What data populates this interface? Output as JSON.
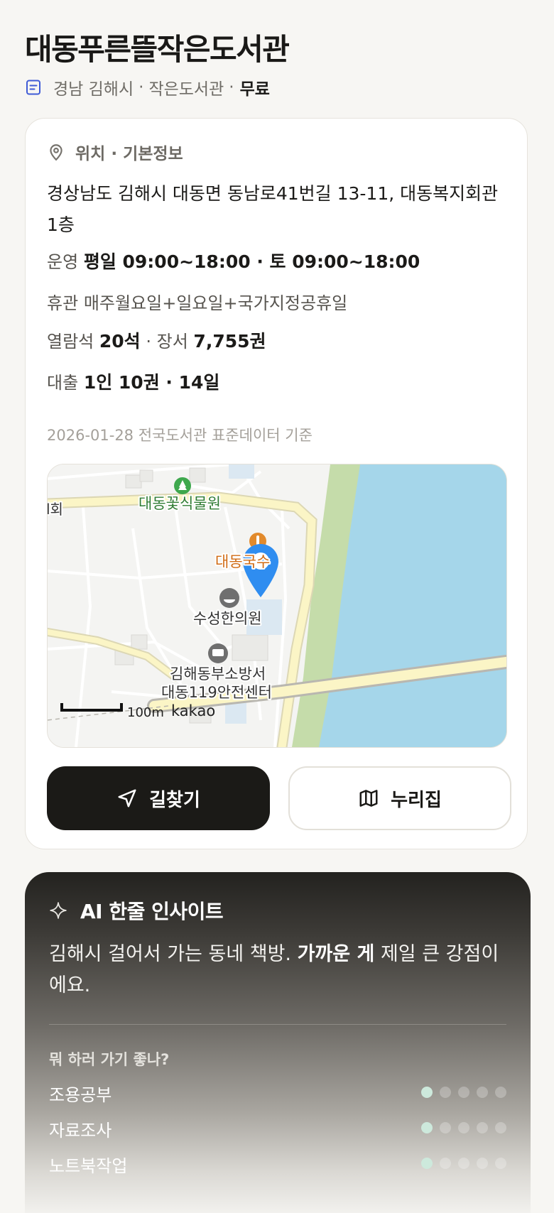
{
  "header": {
    "title": "대동푸른뜰작은도서관",
    "region": "경남 김해시",
    "sep1": "·",
    "type": "작은도서관",
    "sep2": "·",
    "fee": "무료"
  },
  "info": {
    "section_title": "위치 · 기본정보",
    "address": "경상남도 김해시 대동면 동남로41번길 13-11, 대동복지회관 1층",
    "hours_label": "운영",
    "hours_value": "평일 09:00~18:00 · 토 09:00~18:00",
    "closed_label": "휴관",
    "closed_value": "매주월요일+일요일+국가지정공휴일",
    "seats_label": "열람석",
    "seats_value": "20석",
    "sep": "·",
    "books_label": "장서",
    "books_value": "7,755권",
    "loan_label": "대출",
    "loan_value": "1인 10권 · 14일",
    "as_of": "2026-01-28 전국도서관 표준데이터 기준"
  },
  "map": {
    "labels": {
      "botanical": "대동꽃식물원",
      "left_partial": "l회",
      "restaurant": "대동국수",
      "clinic": "수성한의원",
      "fire1": "김해동부소방서",
      "fire2": "대동119안전센터",
      "scale": "100m",
      "brand": "kakao"
    },
    "colors": {
      "water": "#a5d6ea",
      "bank": "#c5dcaa",
      "road": "#fbf5c6",
      "pin": "#2f8df0"
    }
  },
  "actions": {
    "directions_label": "길찾기",
    "nurizip_label": "누리집"
  },
  "ai": {
    "title": "AI 한줄 인사이트",
    "text_pre": "김해시 걸어서 가는 동네 책방.",
    "text_bold": "가까운 게",
    "text_post": "제일 큰 강점이에요.",
    "question": "뭐 하러 가기 좋나?",
    "activities": [
      {
        "label": "조용공부",
        "rating": 1,
        "max": 5
      },
      {
        "label": "자료조사",
        "rating": 1,
        "max": 5
      },
      {
        "label": "노트북작업",
        "rating": 1,
        "max": 5
      }
    ]
  }
}
